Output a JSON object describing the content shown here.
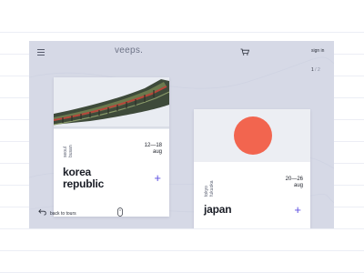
{
  "header": {
    "logo": "veeps.",
    "signin_label": "sign in",
    "icons": [
      "menu-icon",
      "cart-icon"
    ]
  },
  "pager": {
    "current": "1",
    "separator": "/",
    "total": "2"
  },
  "cards": [
    {
      "cities": [
        "seoul",
        "busan"
      ],
      "dates": "12—18",
      "month": "aug",
      "country_line1": "korea",
      "country_line2": "republic",
      "plus": "+"
    },
    {
      "cities": [
        "tokyo",
        "fukuoka"
      ],
      "dates": "20—26",
      "month": "aug",
      "country_line1": "japan",
      "plus": "+",
      "sun_color": "#f2654f"
    }
  ],
  "footer": {
    "back_label": "back to tours",
    "icons": [
      "back-arrow-icon",
      "mouse-scroll-icon"
    ]
  },
  "colors": {
    "panel": "#d6d9e6",
    "accent": "#5b4de0",
    "text": "#1a1d26"
  }
}
